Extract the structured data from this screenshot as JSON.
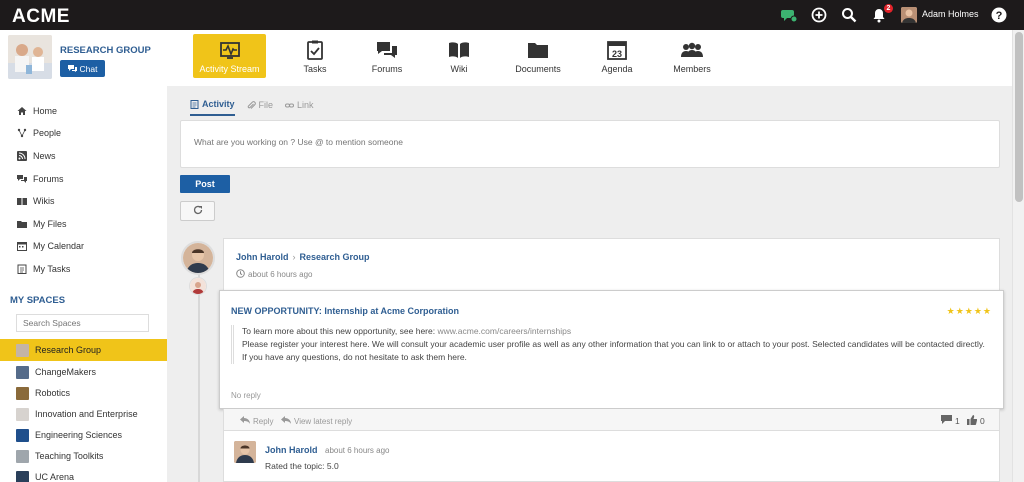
{
  "brand": "ACME",
  "topbar": {
    "icons": [
      "chat-status-icon",
      "add-icon",
      "search-icon",
      "notifications-icon",
      "help-icon"
    ],
    "notification_count": "2",
    "user_name": "Adam Holmes"
  },
  "space": {
    "name": "RESEARCH GROUP",
    "chat_label": "Chat"
  },
  "sidebar": {
    "items": [
      {
        "label": "Home",
        "icon": "home-icon"
      },
      {
        "label": "People",
        "icon": "people-icon"
      },
      {
        "label": "News",
        "icon": "rss-icon"
      },
      {
        "label": "Forums",
        "icon": "forum-icon"
      },
      {
        "label": "Wikis",
        "icon": "wiki-icon"
      },
      {
        "label": "My Files",
        "icon": "files-icon"
      },
      {
        "label": "My Calendar",
        "icon": "calendar-icon"
      },
      {
        "label": "My Tasks",
        "icon": "tasks-icon"
      }
    ],
    "myspaces_title": "MY SPACES",
    "search_placeholder": "Search Spaces",
    "spaces": [
      {
        "label": "Research Group",
        "active": true
      },
      {
        "label": "ChangeMakers",
        "active": false
      },
      {
        "label": "Robotics",
        "active": false
      },
      {
        "label": "Innovation and Enterprise",
        "active": false
      },
      {
        "label": "Engineering Sciences",
        "active": false
      },
      {
        "label": "Teaching Toolkits",
        "active": false
      },
      {
        "label": "UC Arena",
        "active": false
      }
    ]
  },
  "appnav": {
    "tabs": [
      {
        "label": "Activity Stream",
        "icon": "activity-stream-icon",
        "active": true
      },
      {
        "label": "Tasks",
        "icon": "tasks-icon",
        "active": false
      },
      {
        "label": "Forums",
        "icon": "forums-icon",
        "active": false
      },
      {
        "label": "Wiki",
        "icon": "wiki-book-icon",
        "active": false
      },
      {
        "label": "Documents",
        "icon": "folder-icon",
        "active": false
      },
      {
        "label": "Agenda",
        "icon": "agenda-icon",
        "active": false,
        "day": "23"
      },
      {
        "label": "Members",
        "icon": "members-icon",
        "active": false
      }
    ]
  },
  "composer": {
    "tabs": [
      {
        "label": "Activity",
        "active": true
      },
      {
        "label": "File",
        "active": false
      },
      {
        "label": "Link",
        "active": false
      }
    ],
    "placeholder": "What are you working on ? Use @ to mention someone",
    "post_label": "Post"
  },
  "activity": {
    "author": "John Harold",
    "separator": "›",
    "space": "Research Group",
    "time": "about 6 hours ago",
    "topic": {
      "title": "NEW OPPORTUNITY: Internship at Acme Corporation",
      "stars": "★★★★★",
      "line1_text": "To learn more about this new opportunity, see here: ",
      "line1_link": "www.acme.com/careers/internships",
      "line2": "Please register your interest here. We will consult your academic user profile as well as any other information that you can link to or attach to your post. Selected candidates will be contacted directly.",
      "line3": "If you have any questions, do not hesitate to ask them here.",
      "no_reply": "No reply"
    },
    "reply_label": "Reply",
    "view_latest_label": "View latest reply",
    "comment_count": "1",
    "like_count": "0",
    "comment": {
      "author": "John Harold",
      "time": "about 6 hours ago",
      "text": "Rated the topic: 5.0"
    }
  },
  "colors": {
    "topbar": "#1d1a1b",
    "accent_yellow": "#f0c419",
    "link_blue": "#2f5e92",
    "button_blue": "#1d5fa4",
    "notification_red": "#e4232a",
    "status_green": "#3cb371"
  }
}
